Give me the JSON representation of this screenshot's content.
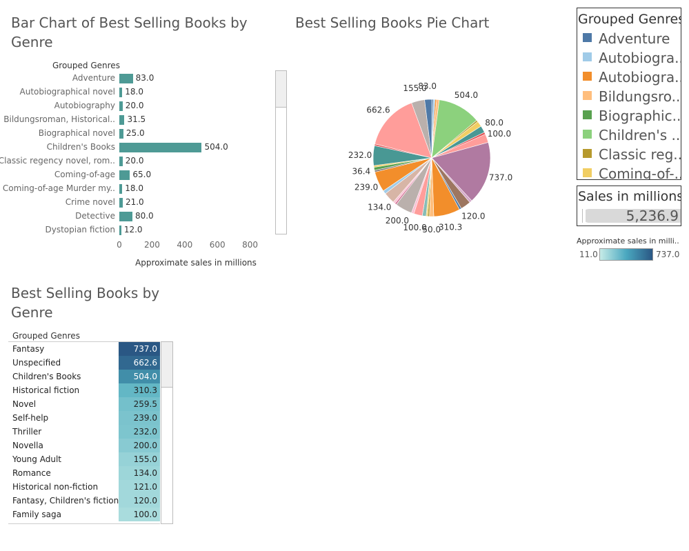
{
  "bar_section": {
    "title_line1": "Bar Chart of Best Selling Books by",
    "title_line2": "Genre",
    "column_header": "Grouped Genres",
    "bar_color": "#4e9a95"
  },
  "pie_section": {
    "title": "Best Selling Books Pie Chart"
  },
  "table_section": {
    "title_line1": "Best Selling Books by",
    "title_line2": "Genre",
    "column_header": "Grouped Genres"
  },
  "legend": {
    "title": "Grouped Genres",
    "items": [
      {
        "label": "Adventure",
        "color": "#4e79a7"
      },
      {
        "label": "Autobiogra..",
        "color": "#a0cbe8"
      },
      {
        "label": "Autobiogra..",
        "color": "#f28e2b"
      },
      {
        "label": "Bildungsro..",
        "color": "#ffbe7d"
      },
      {
        "label": "Biographic..",
        "color": "#59a14f"
      },
      {
        "label": "Children's ..",
        "color": "#8cd17d"
      },
      {
        "label": "Classic reg..",
        "color": "#b6992d"
      },
      {
        "label": "Coming-of-..",
        "color": "#f1ce63"
      }
    ]
  },
  "total_filter": {
    "title": "Sales in millions",
    "value": "5,236.9"
  },
  "color_legend": {
    "title": "Approximate sales in milli..",
    "min_label": "11.0",
    "max_label": "737.0",
    "color_low": "#c6ebe7",
    "color_high": "#2a5784"
  },
  "chart_data": [
    {
      "type": "bar",
      "title": "Bar Chart of Best Selling Books by Genre",
      "orientation": "horizontal",
      "ylabel": "Grouped Genres",
      "xlabel": "Approximate sales in millions",
      "xlim": [
        0,
        900
      ],
      "xticks": [
        0,
        200,
        400,
        600,
        800
      ],
      "xtick_labels": [
        "0",
        "200",
        "400",
        "600",
        "800"
      ],
      "categories": [
        "Adventure",
        "Autobiographical novel",
        "Autobiography",
        "Bildungsroman, Historical..",
        "Biographical novel",
        "Children's Books",
        "Classic regency novel, rom..",
        "Coming-of-age",
        "Coming-of-age Murder my..",
        "Crime novel",
        "Detective",
        "Dystopian fiction"
      ],
      "values": [
        83.0,
        18.0,
        20.0,
        31.5,
        25.0,
        504.0,
        20.0,
        65.0,
        18.0,
        21.0,
        80.0,
        12.0
      ],
      "value_labels": [
        "83.0",
        "18.0",
        "20.0",
        "31.5",
        "25.0",
        "504.0",
        "20.0",
        "65.0",
        "18.0",
        "21.0",
        "80.0",
        "12.0"
      ],
      "grid": false
    },
    {
      "type": "pie",
      "title": "Best Selling Books Pie Chart",
      "slices": [
        {
          "value": 18.0,
          "color": "#4e79a7"
        },
        {
          "value": 20.0,
          "color": "#a0cbe8"
        },
        {
          "value": 18.0,
          "color": "#f28e2b"
        },
        {
          "value": 31.5,
          "color": "#ffbe7d"
        },
        {
          "value": 504.0,
          "color": "#8cd17d",
          "label": "504.0"
        },
        {
          "value": 20.0,
          "color": "#b6992d"
        },
        {
          "value": 65.0,
          "color": "#f1ce63"
        },
        {
          "value": 80.0,
          "color": "#499894",
          "label": "80.0"
        },
        {
          "value": 25.0,
          "color": "#e15759"
        },
        {
          "value": 100.0,
          "color": "#ff9d9a",
          "label": "100.0"
        },
        {
          "value": 737.0,
          "color": "#b07aa1",
          "label": "737.0"
        },
        {
          "value": 30.0,
          "color": "#d4a6c8"
        },
        {
          "value": 120.0,
          "color": "#9d7660",
          "label": "120.0"
        },
        {
          "value": 25.0,
          "color": "#4e79a7"
        },
        {
          "value": 310.3,
          "color": "#f28e2b",
          "label": "310.3"
        },
        {
          "value": 50.0,
          "color": "#ffbe7d",
          "label": "50.0"
        },
        {
          "value": 21.0,
          "color": "#b6992d"
        },
        {
          "value": 18.0,
          "color": "#f1ce63"
        },
        {
          "value": 45.0,
          "color": "#86bcb6"
        },
        {
          "value": 100.0,
          "color": "#ff9d9a",
          "label": "100.0"
        },
        {
          "value": 30.0,
          "color": "#fabfd2"
        },
        {
          "value": 200.0,
          "color": "#bab0ac",
          "label": "200.0"
        },
        {
          "value": 20.0,
          "color": "#d37295"
        },
        {
          "value": 25.0,
          "color": "#fabfd2"
        },
        {
          "value": 134.0,
          "color": "#d7b5a6",
          "label": "134.0"
        },
        {
          "value": 40.0,
          "color": "#a0cbe8"
        },
        {
          "value": 239.0,
          "color": "#f28e2b",
          "label": "239.0"
        },
        {
          "value": 20.0,
          "color": "#79706e"
        },
        {
          "value": 36.4,
          "color": "#59a14f",
          "label": "36.4"
        },
        {
          "value": 20.0,
          "color": "#f1ce63"
        },
        {
          "value": 232.0,
          "color": "#499894",
          "label": "232.0"
        },
        {
          "value": 20.0,
          "color": "#e15759"
        },
        {
          "value": 662.6,
          "color": "#ff9d9a",
          "label": "662.6"
        },
        {
          "value": 155.0,
          "color": "#bab0ac",
          "label": "155.0"
        },
        {
          "value": 83.0,
          "color": "#4e79a7",
          "label": "83.0"
        }
      ]
    },
    {
      "type": "table",
      "title": "Best Selling Books by Genre",
      "column_header": "Grouped Genres",
      "rows": [
        {
          "genre": "Fantasy",
          "value": 737.0,
          "label": "737.0"
        },
        {
          "genre": "Unspecified",
          "value": 662.6,
          "label": "662.6"
        },
        {
          "genre": "Children's Books",
          "value": 504.0,
          "label": "504.0"
        },
        {
          "genre": "Historical fiction",
          "value": 310.3,
          "label": "310.3"
        },
        {
          "genre": "Novel",
          "value": 259.5,
          "label": "259.5"
        },
        {
          "genre": "Self-help",
          "value": 239.0,
          "label": "239.0"
        },
        {
          "genre": "Thriller",
          "value": 232.0,
          "label": "232.0"
        },
        {
          "genre": "Novella",
          "value": 200.0,
          "label": "200.0"
        },
        {
          "genre": "Young Adult",
          "value": 155.0,
          "label": "155.0"
        },
        {
          "genre": "Romance",
          "value": 134.0,
          "label": "134.0"
        },
        {
          "genre": "Historical non-fiction",
          "value": 121.0,
          "label": "121.0"
        },
        {
          "genre": "Fantasy, Children's fiction",
          "value": 120.0,
          "label": "120.0"
        },
        {
          "genre": "Family saga",
          "value": 100.0,
          "label": "100.0"
        }
      ],
      "color_range": [
        11.0,
        737.0
      ]
    }
  ]
}
